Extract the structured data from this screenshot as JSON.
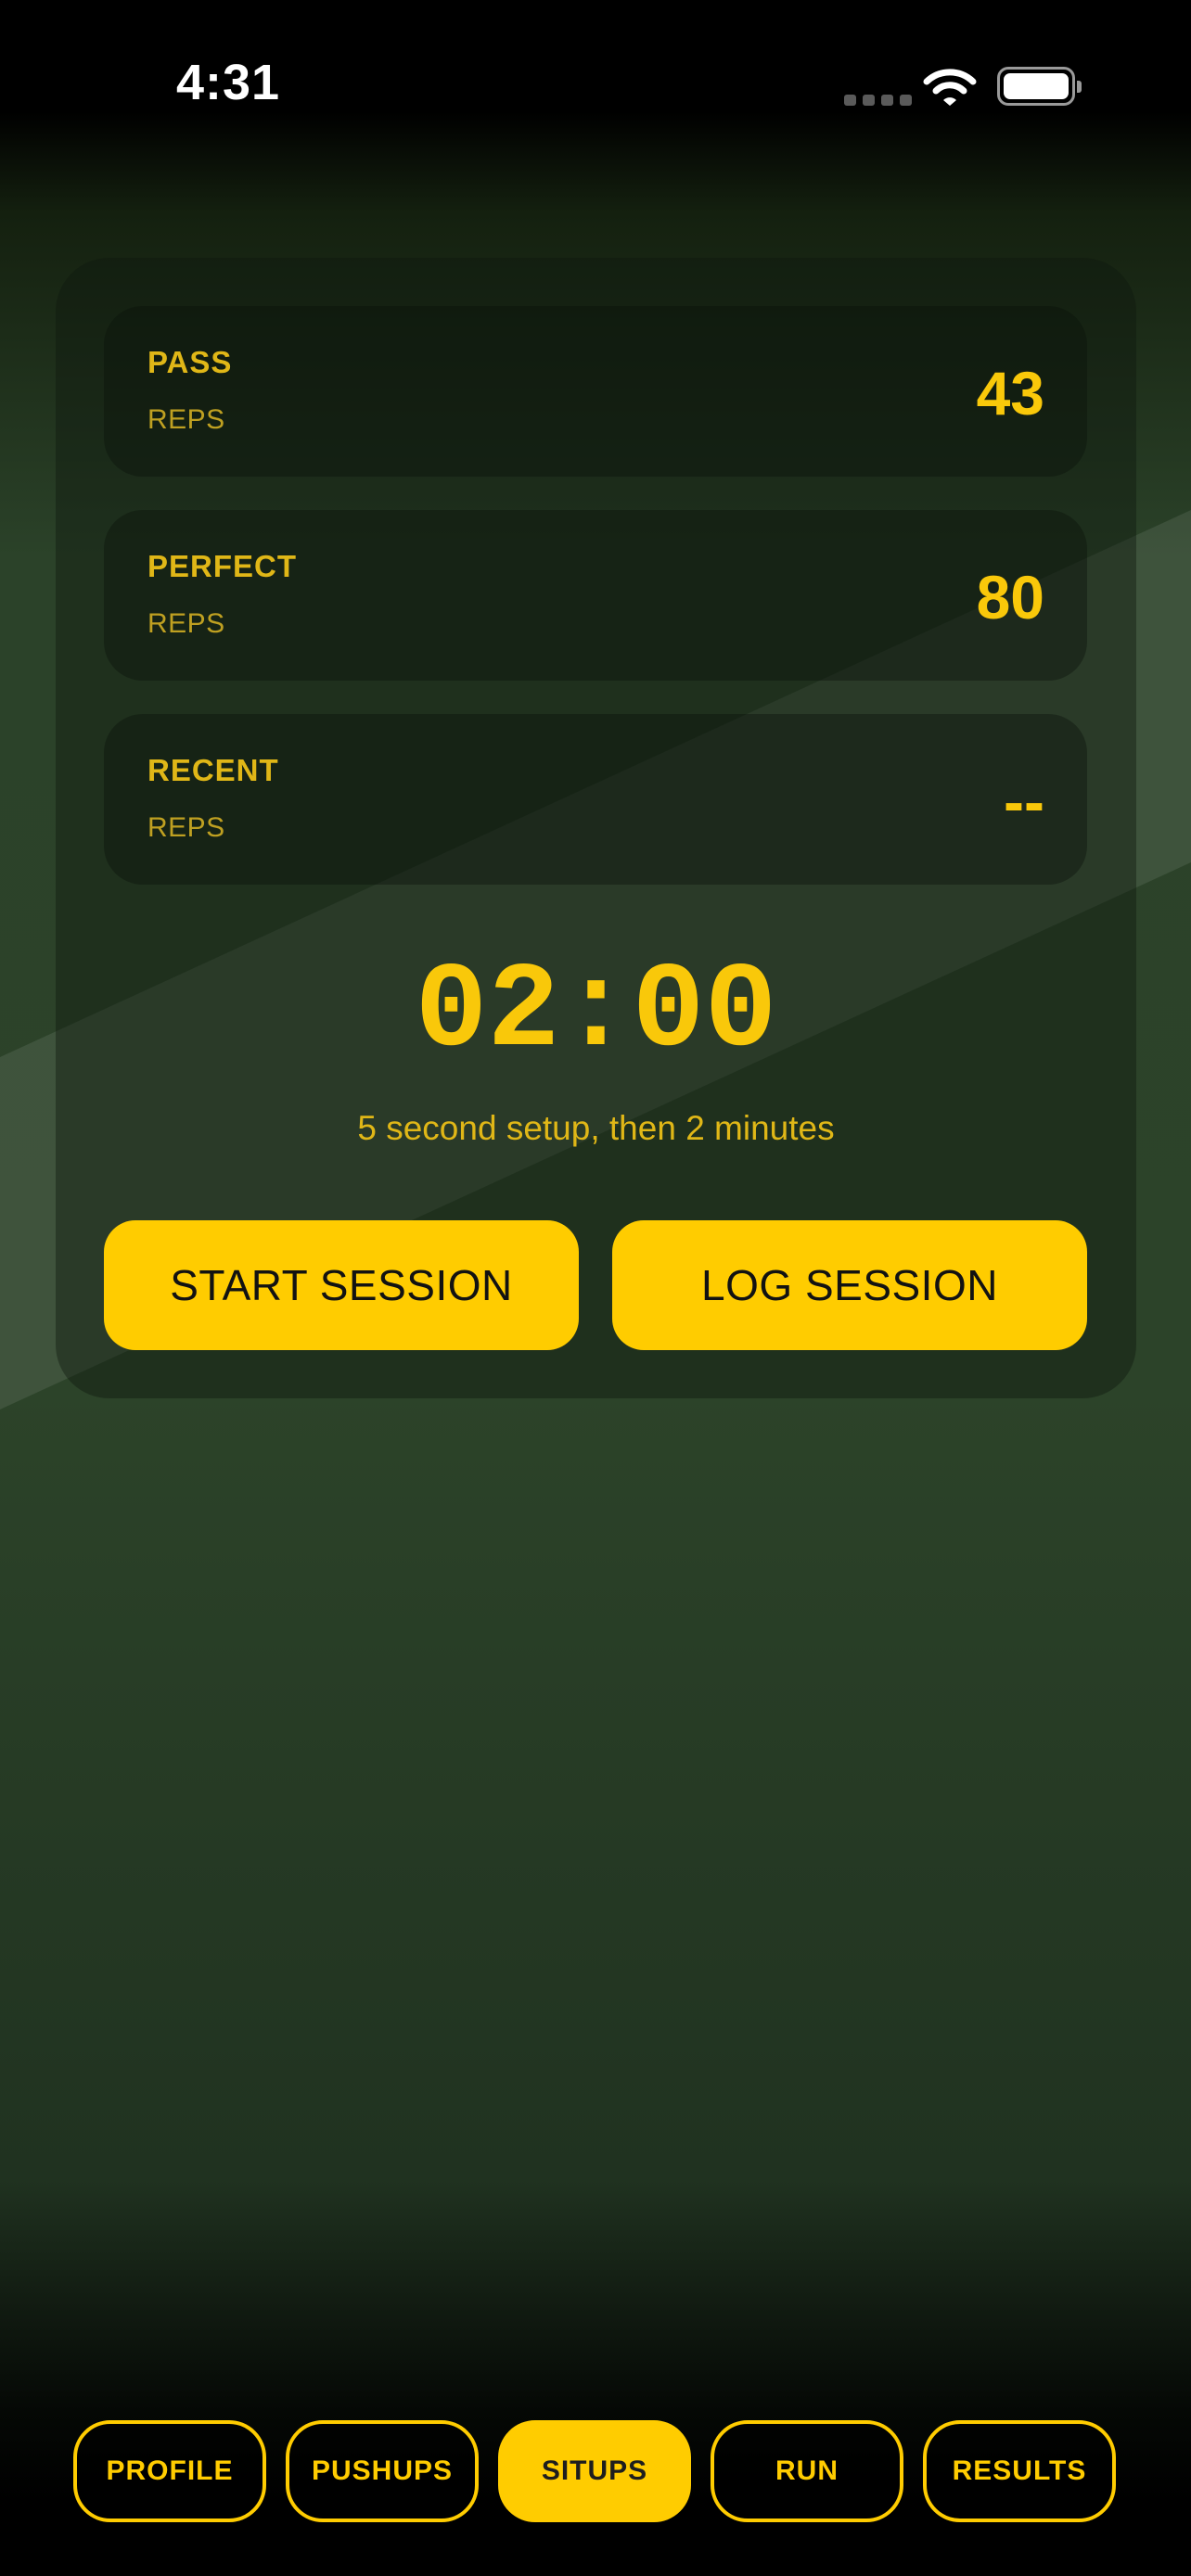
{
  "status_bar": {
    "time": "4:31"
  },
  "stats": [
    {
      "label": "PASS",
      "unit": "REPS",
      "value": "43"
    },
    {
      "label": "PERFECT",
      "unit": "REPS",
      "value": "80"
    },
    {
      "label": "RECENT",
      "unit": "REPS",
      "value": "--"
    }
  ],
  "timer": {
    "display": "02:00",
    "caption": "5 second setup, then 2 minutes"
  },
  "actions": {
    "start_label": "START SESSION",
    "log_label": "LOG SESSION"
  },
  "tabs": [
    {
      "label": "PROFILE",
      "active": false
    },
    {
      "label": "PUSHUPS",
      "active": false
    },
    {
      "label": "SITUPS",
      "active": true
    },
    {
      "label": "RUN",
      "active": false
    },
    {
      "label": "RESULTS",
      "active": false
    }
  ],
  "colors": {
    "accent": "#ffcc00",
    "accent_text": "#f9c80a",
    "background": "#2c4329"
  },
  "icons": [
    "cellular-signal-icon",
    "wifi-icon",
    "battery-icon"
  ]
}
